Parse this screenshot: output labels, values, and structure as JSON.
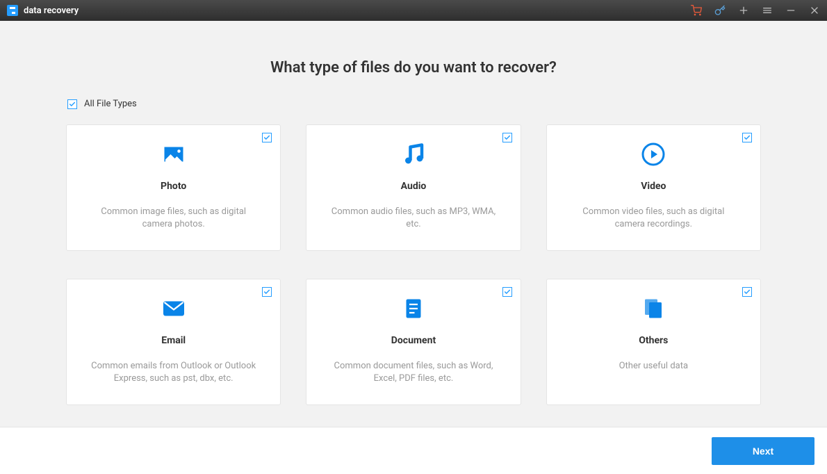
{
  "app": {
    "title": "data recovery"
  },
  "main": {
    "heading": "What type of files do you want to recover?",
    "all_types_label": "All File Types",
    "all_types_checked": true,
    "next_label": "Next"
  },
  "cards": [
    {
      "id": "photo",
      "title": "Photo",
      "desc": "Common image files, such as digital camera photos.",
      "checked": true
    },
    {
      "id": "audio",
      "title": "Audio",
      "desc": "Common audio files, such as MP3, WMA, etc.",
      "checked": true
    },
    {
      "id": "video",
      "title": "Video",
      "desc": "Common video files, such as digital camera recordings.",
      "checked": true
    },
    {
      "id": "email",
      "title": "Email",
      "desc": "Common emails from Outlook or Outlook Express, such as pst, dbx, etc.",
      "checked": true
    },
    {
      "id": "document",
      "title": "Document",
      "desc": "Common document files, such as Word, Excel, PDF files, etc.",
      "checked": true
    },
    {
      "id": "others",
      "title": "Others",
      "desc": "Other useful data",
      "checked": true
    }
  ],
  "colors": {
    "accent": "#249dff",
    "primary_btn": "#1e8fe8"
  }
}
